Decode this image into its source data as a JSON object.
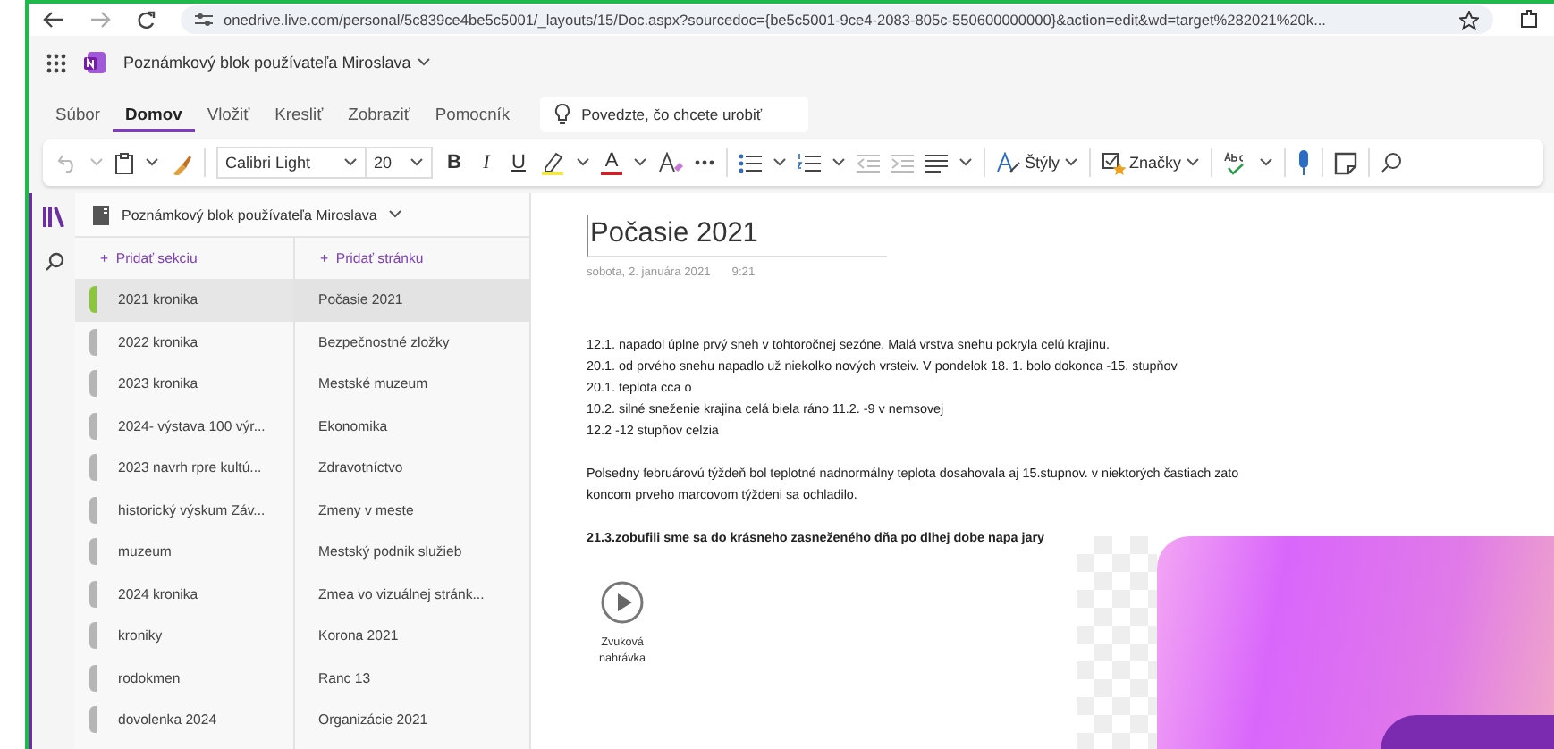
{
  "browser": {
    "url": "onedrive.live.com/personal/5c839ce4be5c5001/_layouts/15/Doc.aspx?sourcedoc={be5c5001-9ce4-2083-805c-550600000000}&action=edit&wd=target%282021%20k..."
  },
  "app_bar": {
    "notebook_title": "Poznámkový blok používateľa Miroslava"
  },
  "ribbon_tabs": [
    {
      "label": "Súbor",
      "selected": false
    },
    {
      "label": "Domov",
      "selected": true
    },
    {
      "label": "Vložiť",
      "selected": false
    },
    {
      "label": "Kresliť",
      "selected": false
    },
    {
      "label": "Zobraziť",
      "selected": false
    },
    {
      "label": "Pomocník",
      "selected": false
    }
  ],
  "tell_me": {
    "placeholder": "Povedzte, čo chcete urobiť"
  },
  "toolbar": {
    "font": "Calibri Light",
    "size": "20",
    "bold": "B",
    "italic": "I",
    "underline": "U",
    "font_color": "A",
    "styles": "Štýly",
    "tags": "Značky"
  },
  "navigation": {
    "notebook": "Poznámkový blok používateľa Miroslava",
    "add_section": "+  Pridať sekciu",
    "add_page": "+  Pridať stránku",
    "sections": [
      {
        "name": "2021 kronika",
        "selected": true,
        "color": "#8cc63f"
      },
      {
        "name": "2022 kronika",
        "selected": false,
        "color": "#b5b5b5"
      },
      {
        "name": "2023 kronika",
        "selected": false,
        "color": "#b5b5b5"
      },
      {
        "name": "2024- výstava 100 výr...",
        "selected": false,
        "color": "#b5b5b5"
      },
      {
        "name": "2023 navrh rpre kultú...",
        "selected": false,
        "color": "#b5b5b5"
      },
      {
        "name": "historický výskum Záv...",
        "selected": false,
        "color": "#b5b5b5"
      },
      {
        "name": "muzeum",
        "selected": false,
        "color": "#b5b5b5"
      },
      {
        "name": "2024 kronika",
        "selected": false,
        "color": "#b5b5b5"
      },
      {
        "name": "kroniky",
        "selected": false,
        "color": "#b5b5b5"
      },
      {
        "name": "rodokmen",
        "selected": false,
        "color": "#b5b5b5"
      },
      {
        "name": "dovolenka 2024",
        "selected": false,
        "color": "#b5b5b5"
      }
    ],
    "pages": [
      {
        "label": "Počasie 2021",
        "selected": true
      },
      {
        "label": "Bezpečnostné zložky",
        "selected": false
      },
      {
        "label": "Mestské muzeum",
        "selected": false
      },
      {
        "label": "Ekonomika",
        "selected": false
      },
      {
        "label": "Zdravotníctvo",
        "selected": false
      },
      {
        "label": "Zmeny v meste",
        "selected": false
      },
      {
        "label": "Mestský podnik služieb",
        "selected": false
      },
      {
        "label": "Zmea vo vizuálnej stránk...",
        "selected": false
      },
      {
        "label": "Korona 2021",
        "selected": false
      },
      {
        "label": "Ranc 13",
        "selected": false
      },
      {
        "label": "Organizácie 2021",
        "selected": false
      }
    ]
  },
  "page": {
    "title": "Počasie  2021",
    "date": "sobota, 2. januára 2021",
    "time": "9:21",
    "blocks": [
      [
        "12.1. napadol úplne prvý sneh v tohtoročnej sezóne. Malá vrstva snehu pokryla celú krajinu.",
        "20.1. od  prvého snehu napadlo  už niekolko nových vrsteiv. V pondelok 18. 1. bolo dokonca -15. stupňov",
        "20.1. teplota cca o",
        "10.2. silné sneženie  krajina celá biela ráno 11.2. -9 v nemsovej",
        "12.2  -12 stupňov celzia"
      ],
      [
        "Polsedny februárovú týždeň bol teplotné nadnormálny teplota dosahovala aj 15.stupnov.  v niektorých častiach zato koncom  prveho marcovom  týždeni sa ochladilo."
      ],
      [
        "21.3.zobufili sme sa do krásneho zasneženého dňa po dlhej dobe napa jary"
      ]
    ],
    "audio": {
      "label": "Zvuková nahrávka"
    }
  }
}
